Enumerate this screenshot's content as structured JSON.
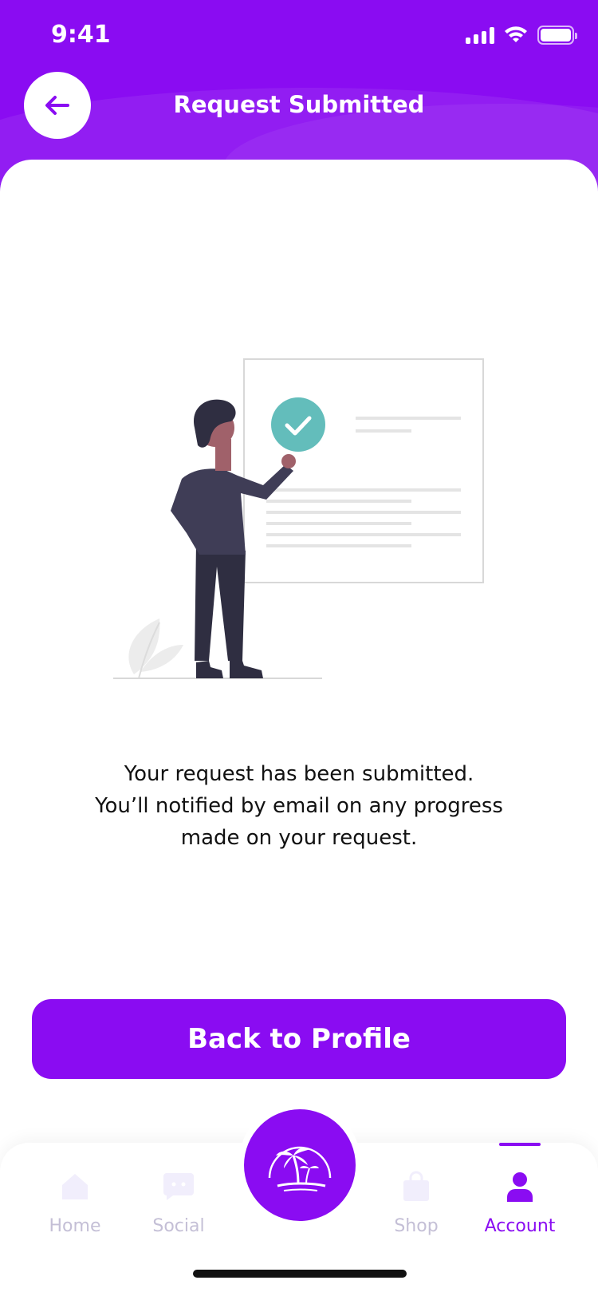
{
  "status_bar": {
    "time": "9:41"
  },
  "header": {
    "title": "Request Submitted"
  },
  "message": {
    "line1": "Your request has been submitted.",
    "line2": "You’ll notified by email on any progress",
    "line3": "made on your request."
  },
  "primary_button": {
    "label": "Back to Profile"
  },
  "tabbar": {
    "items": [
      {
        "label": "Home",
        "icon": "home-icon",
        "active": false
      },
      {
        "label": "Social",
        "icon": "chat-icon",
        "active": false
      },
      {
        "label": "Shop",
        "icon": "shopping-bag-icon",
        "active": false
      },
      {
        "label": "Account",
        "icon": "user-icon",
        "active": true
      }
    ],
    "center_button_icon": "palm-tree-logo-icon"
  },
  "colors": {
    "brand": "#8a0cf2",
    "inactive_tab": "#c4bfd6",
    "check": "#63bdbb"
  }
}
